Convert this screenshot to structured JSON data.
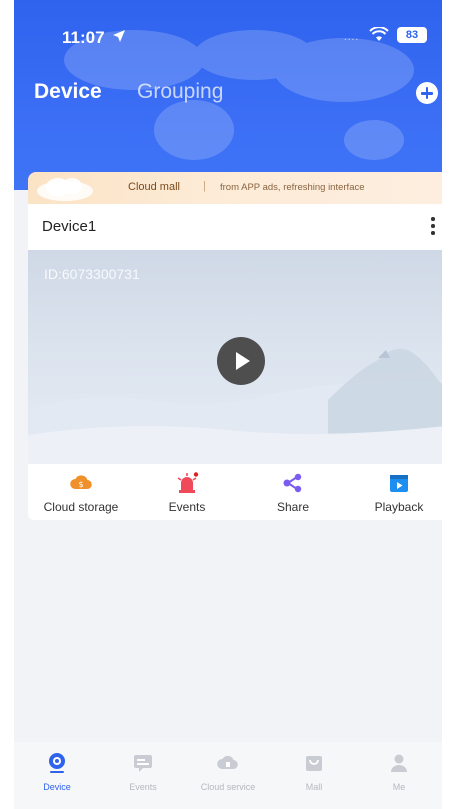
{
  "status_bar": {
    "time": "11:07",
    "signal": "....",
    "battery": "83"
  },
  "header": {
    "tabs": [
      {
        "label": "Device",
        "active": true
      },
      {
        "label": "Grouping",
        "active": false
      }
    ],
    "add_icon": "plus-circle-icon"
  },
  "banner": {
    "title": "Cloud mall",
    "separator": "|",
    "text": "from APP ads, refreshing interface",
    "arrow": ">"
  },
  "device_card": {
    "name": "Device1",
    "device_id": "ID:6073300731",
    "actions": [
      {
        "label": "Cloud storage",
        "icon": "cloud-storage-icon",
        "color": "#f0902a"
      },
      {
        "label": "Events",
        "icon": "alarm-icon",
        "color": "#f04a5a"
      },
      {
        "label": "Share",
        "icon": "share-icon",
        "color": "#7a5cf0"
      },
      {
        "label": "Playback",
        "icon": "playback-icon",
        "color": "#1e8ef0"
      }
    ]
  },
  "bottom_nav": [
    {
      "label": "Device",
      "icon": "device-icon",
      "active": true
    },
    {
      "label": "Events",
      "icon": "events-icon",
      "active": false
    },
    {
      "label": "Cloud service",
      "icon": "cloud-service-icon",
      "active": false
    },
    {
      "label": "Mall",
      "icon": "mall-icon",
      "active": false
    },
    {
      "label": "Me",
      "icon": "person-icon",
      "active": false
    }
  ],
  "colors": {
    "primary": "#2f63ee",
    "inactive": "#b5b8be"
  }
}
